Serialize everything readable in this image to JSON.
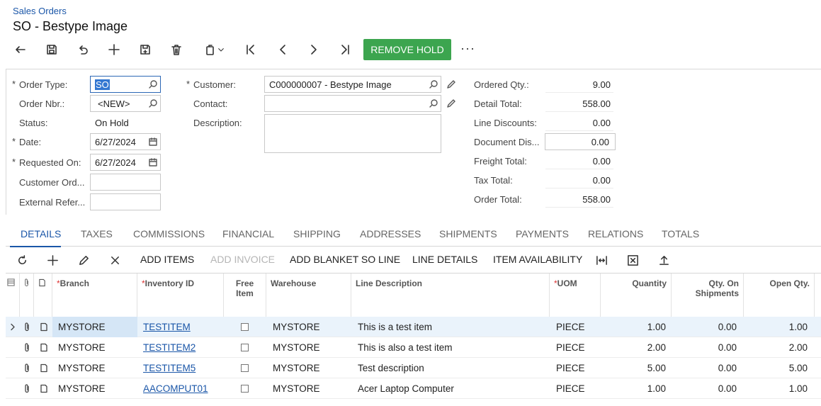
{
  "breadcrumb": "Sales Orders",
  "title": "SO - Bestype Image",
  "toolbar": {
    "remove_hold_label": "REMOVE HOLD",
    "more_label": "···"
  },
  "form": {
    "order_type_label": "Order Type:",
    "order_type_value": "SO",
    "order_nbr_label": "Order Nbr.:",
    "order_nbr_value": "<NEW>",
    "status_label": "Status:",
    "status_value": "On Hold",
    "date_label": "Date:",
    "date_value": "6/27/2024",
    "requested_on_label": "Requested On:",
    "requested_on_value": "6/27/2024",
    "customer_order_label": "Customer Ord...",
    "customer_order_value": "",
    "external_ref_label": "External Refer...",
    "external_ref_value": "",
    "customer_label": "Customer:",
    "customer_value": "C000000007 - Bestype Image",
    "contact_label": "Contact:",
    "contact_value": "",
    "description_label": "Description:",
    "description_value": "",
    "ordered_qty_label": "Ordered Qty.:",
    "ordered_qty_value": "9.00",
    "detail_total_label": "Detail Total:",
    "detail_total_value": "558.00",
    "line_discounts_label": "Line Discounts:",
    "line_discounts_value": "0.00",
    "document_dis_label": "Document Dis...",
    "document_dis_value": "0.00",
    "freight_total_label": "Freight Total:",
    "freight_total_value": "0.00",
    "tax_total_label": "Tax Total:",
    "tax_total_value": "0.00",
    "order_total_label": "Order Total:",
    "order_total_value": "558.00"
  },
  "tabs": [
    "DETAILS",
    "TAXES",
    "COMMISSIONS",
    "FINANCIAL",
    "SHIPPING",
    "ADDRESSES",
    "SHIPMENTS",
    "PAYMENTS",
    "RELATIONS",
    "TOTALS"
  ],
  "active_tab": "DETAILS",
  "grid_toolbar": {
    "add_items": "ADD ITEMS",
    "add_invoice": "ADD INVOICE",
    "add_blanket": "ADD BLANKET SO LINE",
    "line_details": "LINE DETAILS",
    "item_availability": "ITEM AVAILABILITY"
  },
  "grid": {
    "columns": {
      "branch": "Branch",
      "inventory_id": "Inventory ID",
      "free_item": "Free Item",
      "warehouse": "Warehouse",
      "line_description": "Line Description",
      "uom": "UOM",
      "quantity": "Quantity",
      "qty_on_shipments": "Qty. On Shipments",
      "open_qty": "Open Qty."
    },
    "rows": [
      {
        "branch": "MYSTORE",
        "inventory_id": "TESTITEM",
        "free_item": false,
        "warehouse": "MYSTORE",
        "description": "This is a test item",
        "uom": "PIECE",
        "quantity": "1.00",
        "qty_on_shipments": "0.00",
        "open_qty": "1.00"
      },
      {
        "branch": "MYSTORE",
        "inventory_id": "TESTITEM2",
        "free_item": false,
        "warehouse": "MYSTORE",
        "description": "This is also a test item",
        "uom": "PIECE",
        "quantity": "2.00",
        "qty_on_shipments": "0.00",
        "open_qty": "2.00"
      },
      {
        "branch": "MYSTORE",
        "inventory_id": "TESTITEM5",
        "free_item": false,
        "warehouse": "MYSTORE",
        "description": "Test description",
        "uom": "PIECE",
        "quantity": "5.00",
        "qty_on_shipments": "0.00",
        "open_qty": "5.00"
      },
      {
        "branch": "MYSTORE",
        "inventory_id": "AACOMPUT01",
        "free_item": false,
        "warehouse": "MYSTORE",
        "description": "Acer Laptop Computer",
        "uom": "PIECE",
        "quantity": "1.00",
        "qty_on_shipments": "0.00",
        "open_qty": "1.00"
      }
    ]
  },
  "colors": {
    "accent": "#1a56a8",
    "remove_hold": "#3ca54f",
    "selected_row": "#eaf3fb"
  }
}
